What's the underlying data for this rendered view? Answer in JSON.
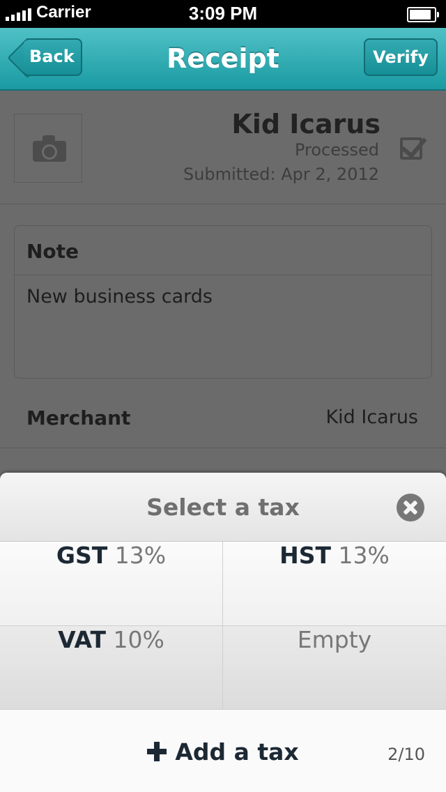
{
  "status_bar": {
    "carrier": "Carrier",
    "time": "3:09 PM"
  },
  "nav": {
    "title": "Receipt",
    "back_label": "Back",
    "verify_label": "Verify"
  },
  "receipt": {
    "name": "Kid Icarus",
    "status": "Processed",
    "submitted": "Submitted: Apr 2, 2012"
  },
  "note": {
    "header": "Note",
    "text": "New business cards"
  },
  "merchant": {
    "label": "Merchant",
    "value": "Kid Icarus"
  },
  "tax_sheet": {
    "title": "Select a tax",
    "options": [
      {
        "name": "GST",
        "rate": "13%"
      },
      {
        "name": "HST",
        "rate": "13%"
      },
      {
        "name": "VAT",
        "rate": "10%"
      },
      {
        "name": "",
        "rate": "Empty"
      }
    ],
    "add_label": "Add a tax",
    "count": "2/10"
  },
  "colors": {
    "accent": "#1a9aa2",
    "text_dark": "#1c2833"
  }
}
